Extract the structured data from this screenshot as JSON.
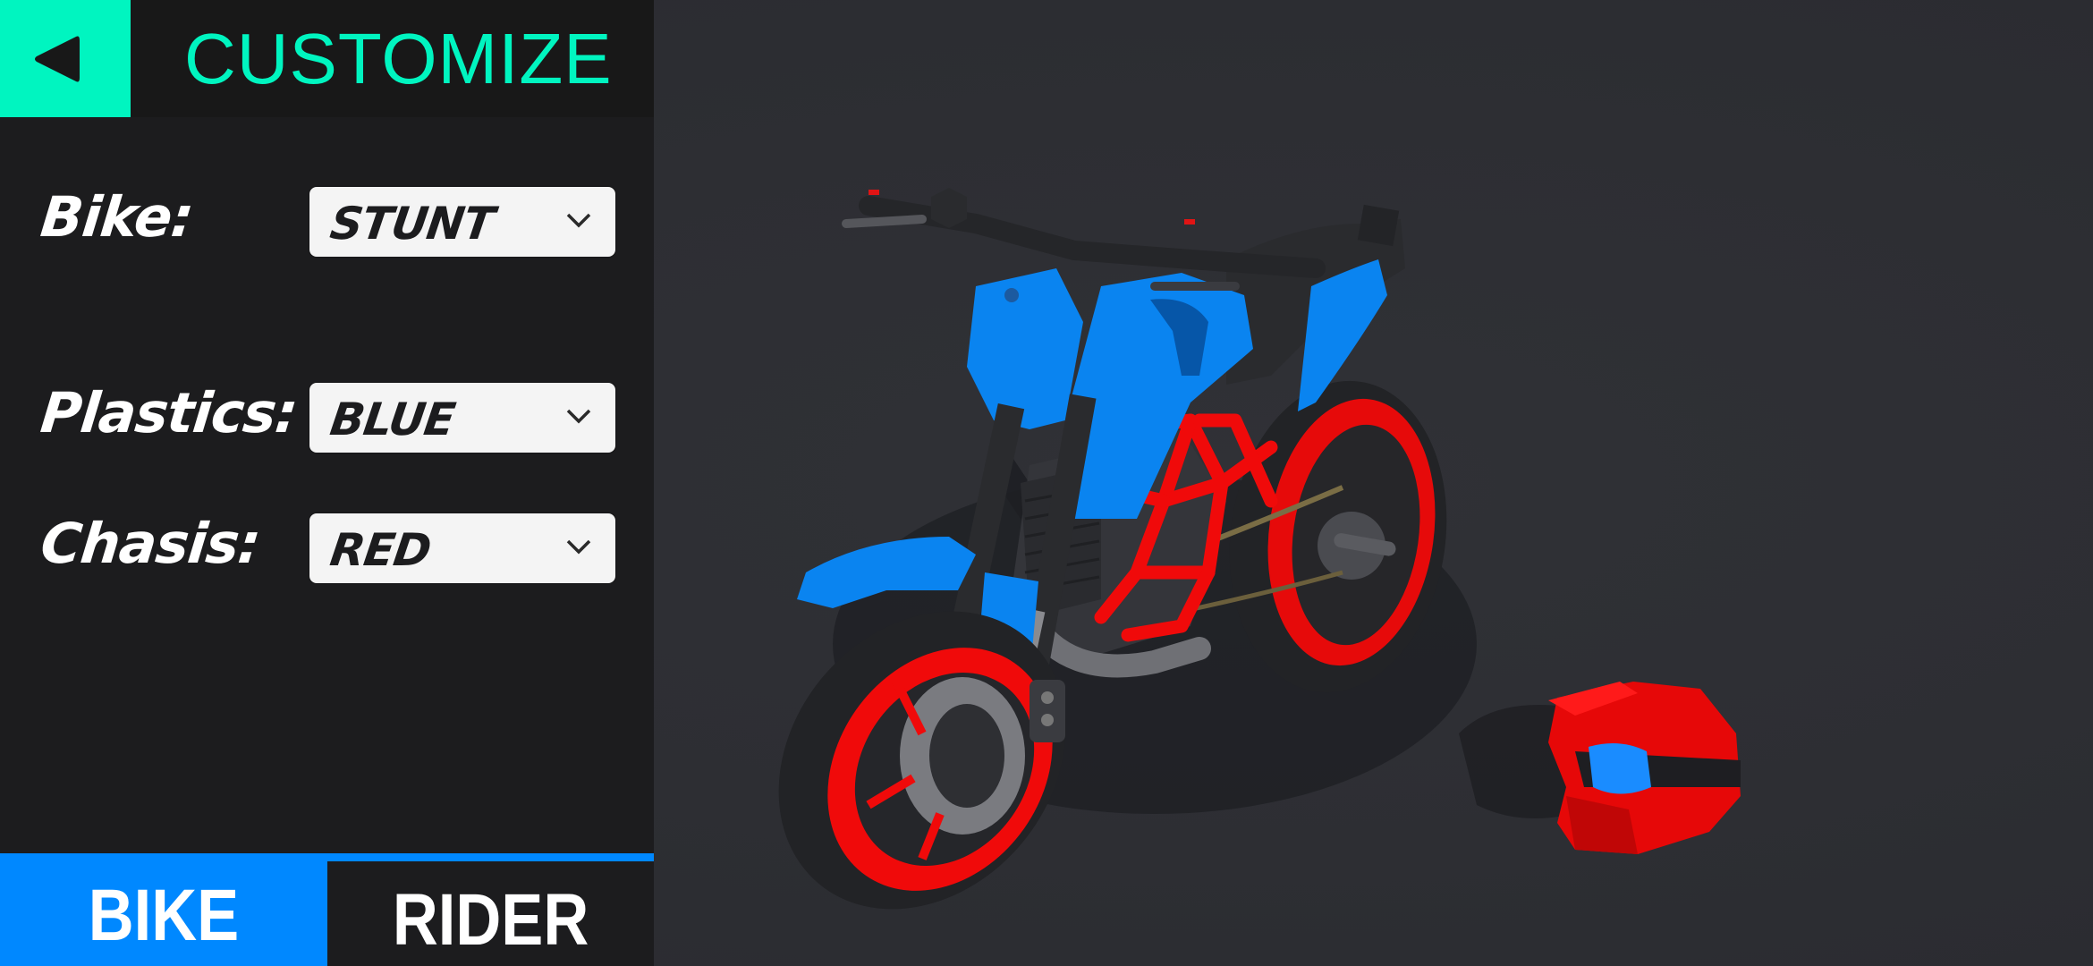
{
  "header": {
    "title": "CUSTOMIZE",
    "back_icon": "back-triangle-icon"
  },
  "options": [
    {
      "label": "Bike:",
      "value": "STUNT",
      "icon": "chevron-down-icon"
    },
    {
      "label": "Plastics:",
      "value": "BLUE",
      "icon": "chevron-down-icon"
    },
    {
      "label": "Chasis:",
      "value": "RED",
      "icon": "chevron-down-icon"
    }
  ],
  "tabs": [
    {
      "label": "BIKE",
      "active": true
    },
    {
      "label": "RIDER",
      "active": false
    }
  ],
  "scene": {
    "model": "motorcycle",
    "accessory": "helmet"
  },
  "colors": {
    "accent_teal": "#00f5c0",
    "accent_blue": "#0088ff",
    "plastics": "#0a84f0",
    "chassis": "#f00a0a",
    "panel_bg": "#1c1c1e",
    "scene_bg": "#2d2e33"
  }
}
